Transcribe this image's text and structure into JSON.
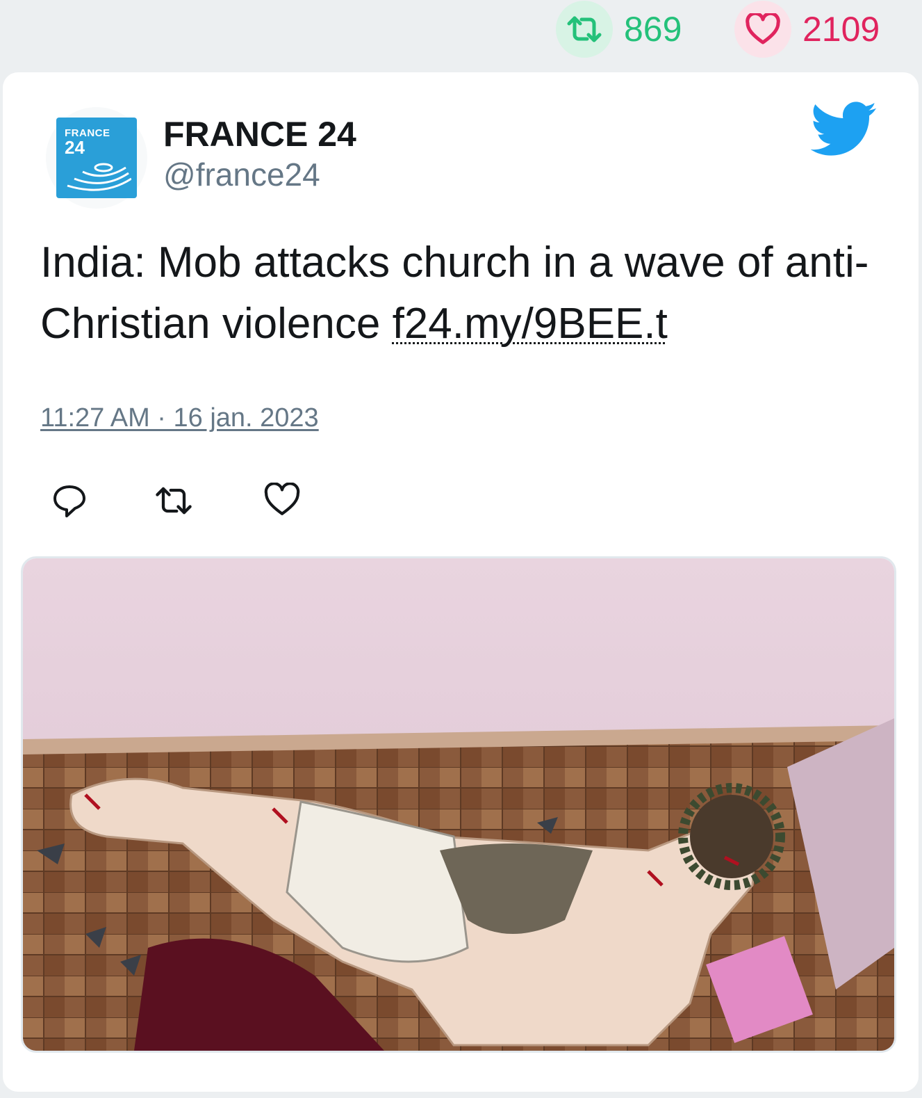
{
  "top_stats": {
    "retweets": "869",
    "likes": "2109",
    "retweet_color": "#24c17a",
    "like_color": "#e0245e"
  },
  "tweet": {
    "author_name": "FRANCE 24",
    "author_handle": "@france24",
    "logo_text_line1": "FRANCE",
    "logo_text_line2": "24",
    "text": "India: Mob attacks church in a wave of anti-Christian violence ",
    "link": "f24.my/9BEE.t",
    "timestamp": "11:27 AM · 16 jan. 2023",
    "icons": {
      "platform": "twitter-bird-icon",
      "reply": "reply-icon",
      "retweet": "retweet-icon",
      "like": "heart-icon"
    },
    "brand_color": "#1da1f2"
  }
}
